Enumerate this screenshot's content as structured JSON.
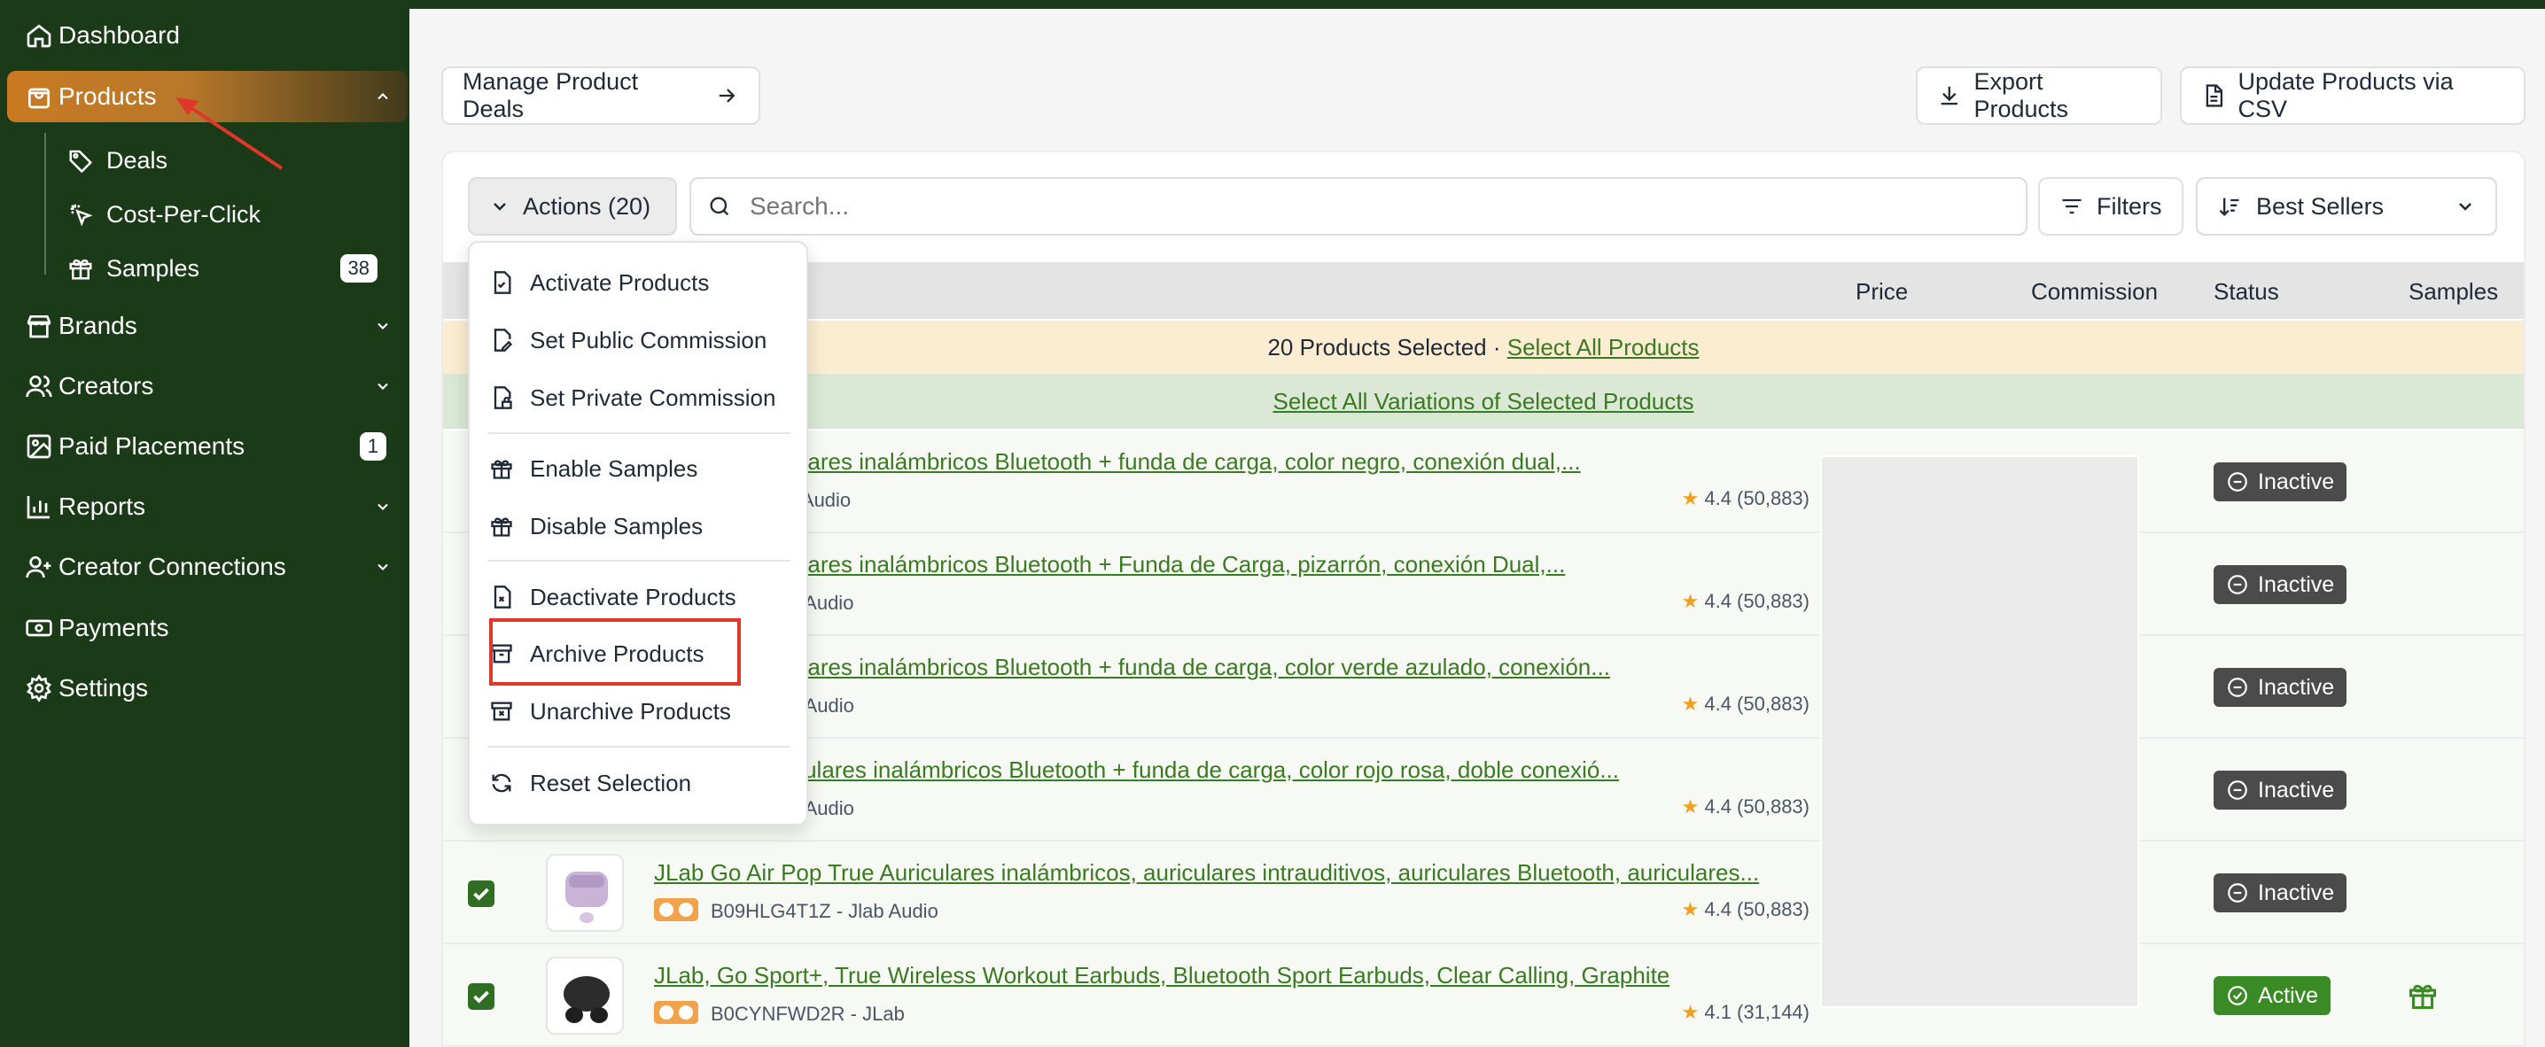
{
  "sidebar": {
    "items": [
      {
        "label": "Dashboard",
        "icon": "home-icon"
      },
      {
        "label": "Products",
        "icon": "bag-icon"
      },
      {
        "label": "Brands",
        "icon": "store-icon"
      },
      {
        "label": "Creators",
        "icon": "users-icon"
      },
      {
        "label": "Paid Placements",
        "icon": "image-icon",
        "badge": "1"
      },
      {
        "label": "Reports",
        "icon": "bar-chart-icon"
      },
      {
        "label": "Creator Connections",
        "icon": "user-plus-icon"
      },
      {
        "label": "Payments",
        "icon": "banknote-icon"
      },
      {
        "label": "Settings",
        "icon": "gear-icon"
      }
    ],
    "products_sub": [
      {
        "label": "Deals",
        "icon": "tag-icon"
      },
      {
        "label": "Cost-Per-Click",
        "icon": "click-icon"
      },
      {
        "label": "Samples",
        "icon": "gift-icon",
        "badge": "38"
      }
    ]
  },
  "toolbar": {
    "manage_deals": "Manage Product Deals",
    "export": "Export Products",
    "update_csv": "Update Products via CSV",
    "actions": "Actions (20)",
    "search_placeholder": "Search...",
    "filters": "Filters",
    "sort": "Best Sellers"
  },
  "menu": {
    "items": [
      "Activate Products",
      "Set Public Commission",
      "Set Private Commission",
      "Enable Samples",
      "Disable Samples",
      "Deactivate Products",
      "Archive Products",
      "Unarchive Products",
      "Reset Selection"
    ]
  },
  "table": {
    "headers": {
      "price": "Price",
      "commission": "Commission",
      "status": "Status",
      "samples": "Samples"
    },
    "selected_text": "20 Products Selected · ",
    "select_all": "Select All Products",
    "select_variations": "Select All Variations of Selected Products",
    "rows": [
      {
        "title": "op True Auriculares inalámbricos Bluetooth + funda de carga, color negro, conexión dual,...",
        "meta": "4TL - Jlab Audio",
        "rating": "4.4 (50,883)",
        "status": "Inactive"
      },
      {
        "title": "op True Auriculares inalámbricos Bluetooth + Funda de Carga, pizarrón, conexión Dual,...",
        "meta": "F4S - Jlab Audio",
        "rating": "4.4 (50,883)",
        "status": "Inactive"
      },
      {
        "title": "op True Auriculares inalámbricos Bluetooth + funda de carga, color verde azulado, conexión...",
        "meta": "HFL - Jlab Audio",
        "rating": "4.4 (50,883)",
        "status": "Inactive"
      },
      {
        "title": "op True - Auriculares inalámbricos Bluetooth + funda de carga, color rojo rosa, doble conexió...",
        "meta": "PXL - Jlab Audio",
        "rating": "4.4 (50,883)",
        "status": "Inactive"
      },
      {
        "title": "JLab Go Air Pop True Auriculares inalámbricos, auriculares intrauditivos, auriculares Bluetooth, auriculares...",
        "meta": "B09HLG4T1Z - Jlab Audio",
        "rating": "4.4 (50,883)",
        "status": "Inactive"
      },
      {
        "title": "JLab, Go Sport+, True Wireless Workout Earbuds, Bluetooth Sport Earbuds, Clear Calling, Graphite",
        "meta": "B0CYNFWD2R - JLab",
        "rating": "4.1 (31,144)",
        "status": "Active"
      }
    ]
  },
  "colors": {
    "sidebar_bg": "#1b3b18",
    "accent": "#c97a22",
    "link": "#3b7a22",
    "active": "#3a8a25",
    "inactive": "#4b4b4b",
    "highlight": "#e0362c"
  }
}
